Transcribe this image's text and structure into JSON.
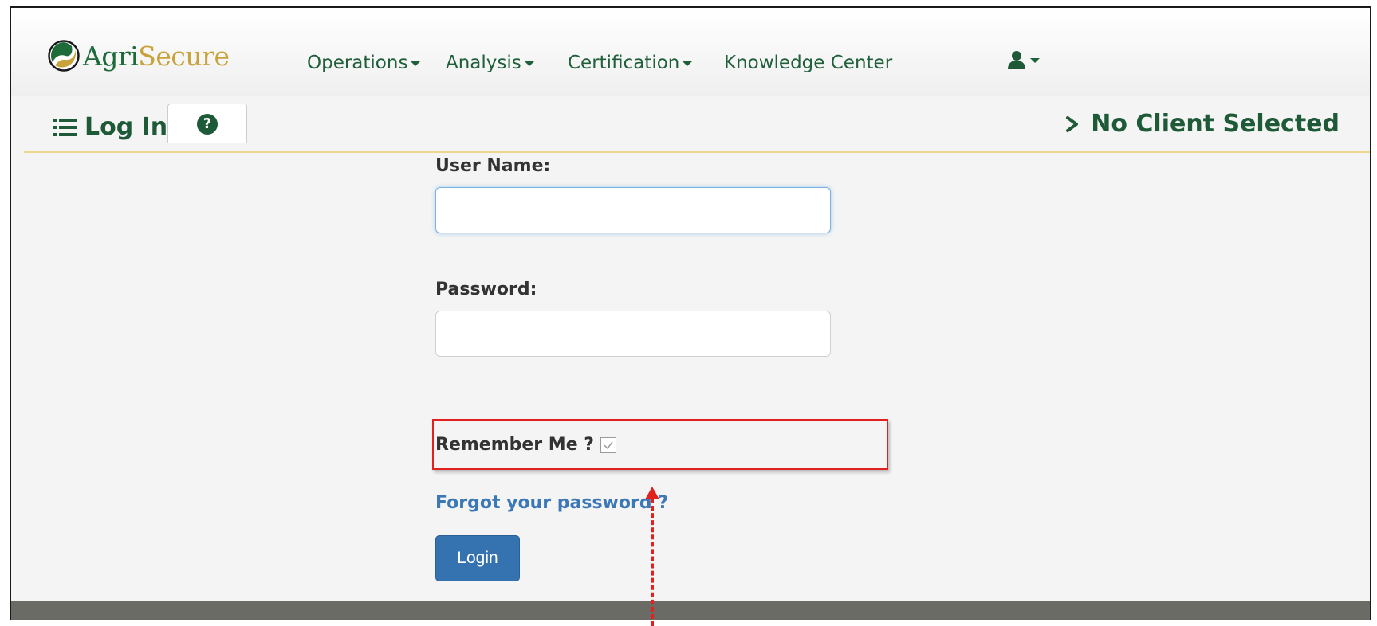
{
  "brand": {
    "part1": "Agri",
    "part2": "Secure",
    "icon": "agrisecure-logo-icon"
  },
  "nav": {
    "items": [
      {
        "label": "Operations",
        "dropdown": true
      },
      {
        "label": "Analysis",
        "dropdown": true
      },
      {
        "label": "Certification",
        "dropdown": true
      },
      {
        "label": "Knowledge Center",
        "dropdown": false
      }
    ],
    "user_icon": "user-icon"
  },
  "page": {
    "title": "Log In",
    "title_icon": "list-icon",
    "help_icon": "question-circle-icon",
    "help_glyph": "?",
    "client_status": "No Client Selected",
    "client_icon": "chevron-right-icon"
  },
  "form": {
    "username_label": "User Name:",
    "username_value": "",
    "password_label": "Password:",
    "password_value": "",
    "remember_label": "Remember Me ?",
    "remember_checked": true,
    "forgot_link": "Forgot your password ?",
    "login_button": "Login"
  },
  "colors": {
    "brand_green": "#1e5a37",
    "brand_gold": "#c8a23a",
    "link_blue": "#3c78b6",
    "button_blue": "#3572b0",
    "annotation_red": "#e0211f",
    "subbar_underline": "#ecd88a",
    "footer_gray": "#6b6b66"
  }
}
